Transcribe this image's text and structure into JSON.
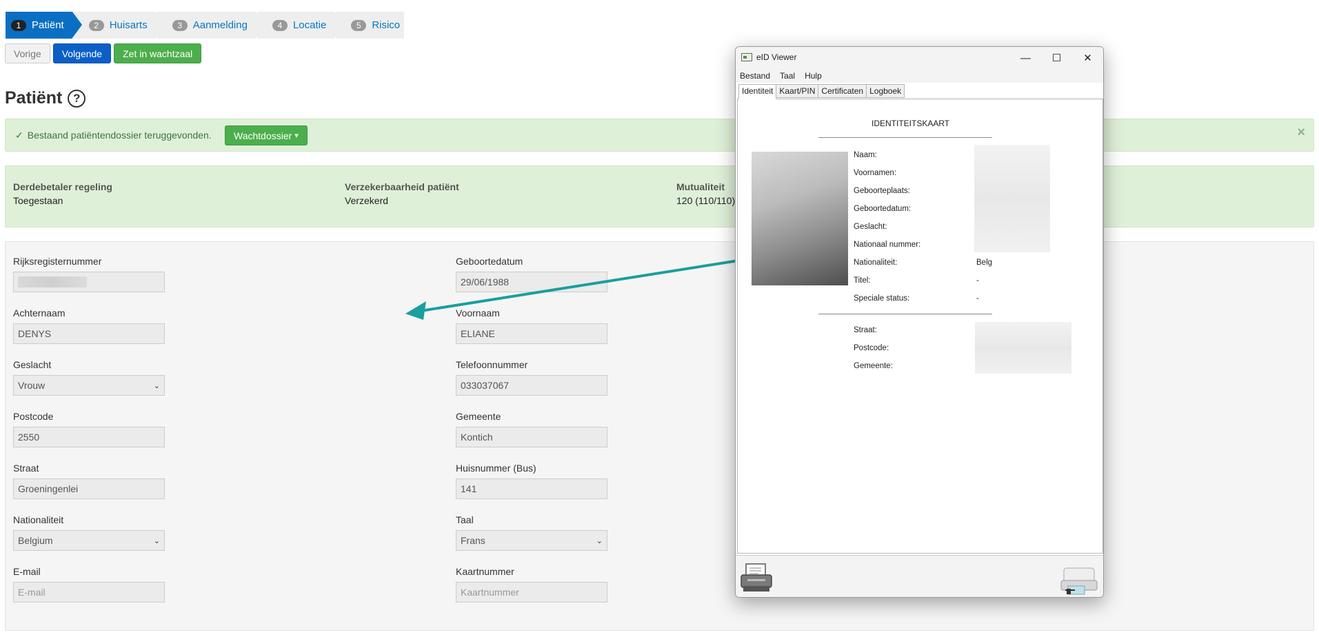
{
  "wizard": {
    "steps": [
      {
        "num": "1",
        "label": "Patiënt"
      },
      {
        "num": "2",
        "label": "Huisarts"
      },
      {
        "num": "3",
        "label": "Aanmelding"
      },
      {
        "num": "4",
        "label": "Locatie"
      },
      {
        "num": "5",
        "label": "Risico"
      }
    ]
  },
  "buttons": {
    "prev": "Vorige",
    "next": "Volgende",
    "waitroom": "Zet in wachtzaal"
  },
  "page": {
    "title": "Patiënt",
    "help": "?"
  },
  "alert": {
    "check": "✓",
    "message": "Bestaand patiëntendossier teruggevonden.",
    "dossier_button": "Wachtdossier",
    "caret": "▾",
    "close": "×"
  },
  "info": {
    "col1": {
      "label": "Derdebetaler regeling",
      "value": "Toegestaan"
    },
    "col2": {
      "label": "Verzekerbaarheid patiënt",
      "value": "Verzekerd"
    },
    "col3": {
      "label": "Mutualiteit",
      "value": "120 (110/110)"
    }
  },
  "form": {
    "rijksregister": {
      "label": "Rijksregisternummer"
    },
    "geboortedatum": {
      "label": "Geboortedatum",
      "value": "29/06/1988"
    },
    "achternaam": {
      "label": "Achternaam",
      "value": "DENYS"
    },
    "voornaam": {
      "label": "Voornaam",
      "value": "ELIANE"
    },
    "geslacht": {
      "label": "Geslacht",
      "value": "Vrouw"
    },
    "telefoon": {
      "label": "Telefoonnummer",
      "value": "033037067"
    },
    "postcode": {
      "label": "Postcode",
      "value": "2550"
    },
    "gemeente": {
      "label": "Gemeente",
      "value": "Kontich"
    },
    "straat": {
      "label": "Straat",
      "value": "Groeningenlei"
    },
    "huisnummer": {
      "label": "Huisnummer (Bus)",
      "value": "141"
    },
    "nationaliteit": {
      "label": "Nationaliteit",
      "value": "Belgium"
    },
    "taal": {
      "label": "Taal",
      "value": "Frans"
    },
    "email": {
      "label": "E-mail",
      "placeholder": "E-mail"
    },
    "kaartnummer": {
      "label": "Kaartnummer",
      "placeholder": "Kaartnummer"
    },
    "chevron": "⌄"
  },
  "eid": {
    "title": "eID Viewer",
    "controls": {
      "min": "—",
      "max": "☐",
      "close": "✕"
    },
    "menu": [
      "Bestand",
      "Taal",
      "Hulp"
    ],
    "tabs": [
      "Identiteit",
      "Kaart/PIN",
      "Certificaten",
      "Logboek"
    ],
    "card_title": "IDENTITEITSKAART",
    "fields": [
      {
        "label": "Naam:",
        "value": ""
      },
      {
        "label": "Voornamen:",
        "value": ""
      },
      {
        "label": "Geboorteplaats:",
        "value": ""
      },
      {
        "label": "Geboortedatum:",
        "value": ""
      },
      {
        "label": "Geslacht:",
        "value": ""
      },
      {
        "label": "Nationaal nummer:",
        "value": ""
      },
      {
        "label": "Nationaliteit:",
        "value": "Belg"
      },
      {
        "label": "Titel:",
        "value": "-"
      },
      {
        "label": "Speciale status:",
        "value": "-"
      }
    ],
    "address": [
      {
        "label": "Straat:"
      },
      {
        "label": "Postcode:"
      },
      {
        "label": "Gemeente:"
      }
    ]
  },
  "colors": {
    "primary": "#0b5fc7",
    "success": "#4cae4c",
    "alert_bg": "#dff0d8",
    "arrow": "#1a9e9e"
  }
}
